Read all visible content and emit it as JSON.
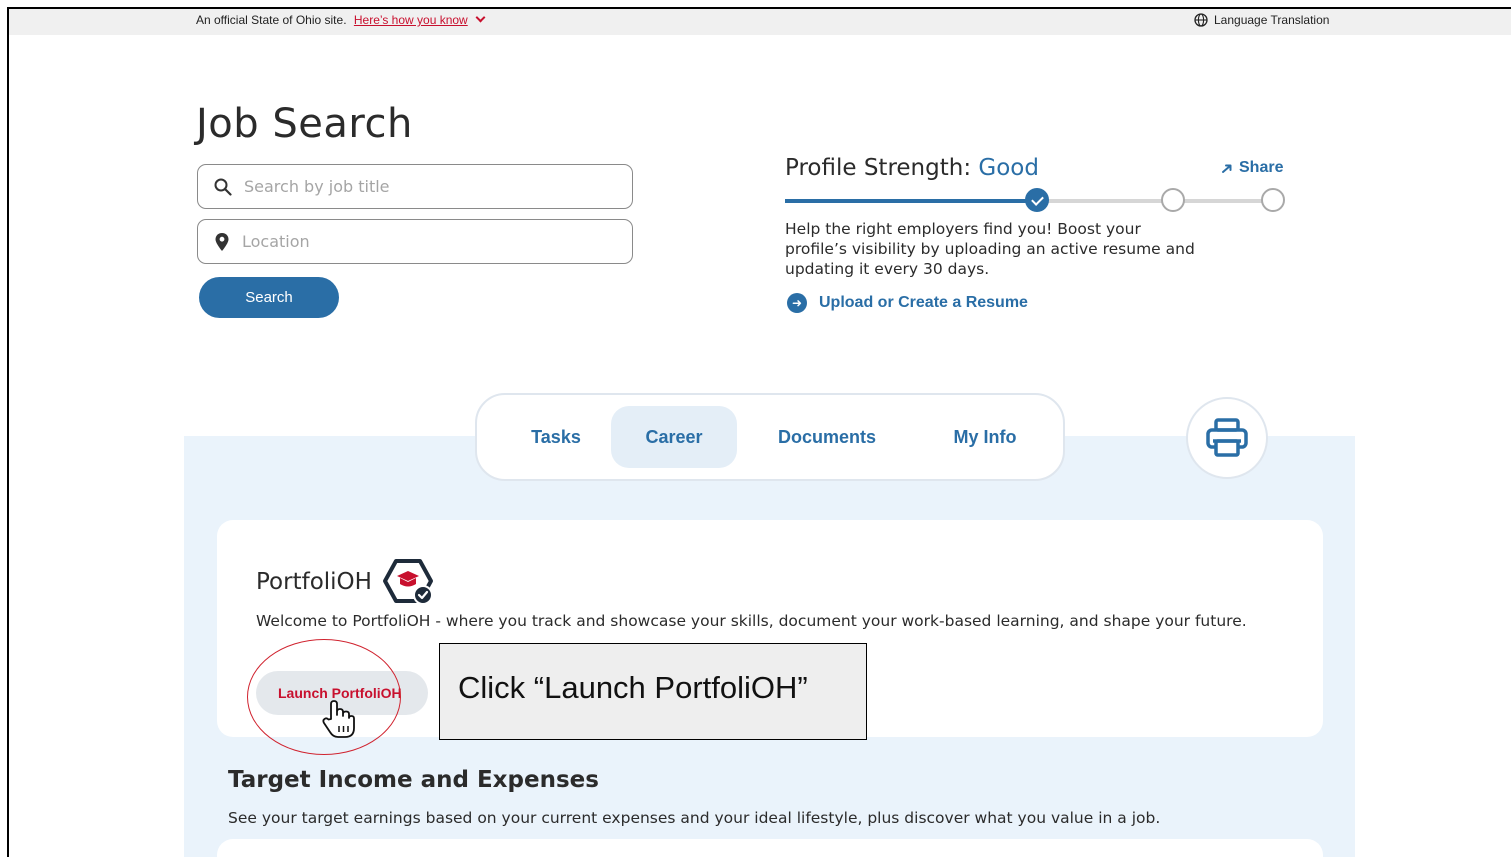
{
  "topbar": {
    "official_text": "An official State of Ohio site.",
    "how_you_know": "Here’s how you know",
    "language": "Language Translation"
  },
  "job_search": {
    "title": "Job Search",
    "search_placeholder": "Search by job title",
    "location_placeholder": "Location",
    "search_button": "Search"
  },
  "profile_strength": {
    "label": "Profile Strength: ",
    "level": "Good",
    "progress_fraction": 0.52,
    "share_label": "Share",
    "description": "Help the right employers find you! Boost your profile’s visibility by uploading an active resume and updating it every 30 days.",
    "upload_link": "Upload or Create a Resume"
  },
  "tabs": [
    {
      "label": "Tasks",
      "active": false
    },
    {
      "label": "Career",
      "active": true
    },
    {
      "label": "Documents",
      "active": false
    },
    {
      "label": "My Info",
      "active": false
    }
  ],
  "portfolioh": {
    "title": "PortfoliOH",
    "description": "Welcome to PortfoliOH - where you track and showcase your skills, document your work-based learning, and shape your future.",
    "launch_button": "Launch PortfoliOH"
  },
  "callout": {
    "text": "Click “Launch PortfoliOH”"
  },
  "target_income": {
    "title": "Target Income and Expenses",
    "description": "See your target earnings based on your current expenses and your ideal lifestyle, plus discover what you value in a job."
  },
  "colors": {
    "primary_blue": "#2a6ea6",
    "ohio_red": "#c8102e",
    "annotation_red": "#d0232f",
    "panel_light_blue": "#eaf3fb"
  },
  "icons": [
    "chevron-down-icon",
    "globe-icon",
    "search-icon",
    "location-pin-icon",
    "share-arrow-icon",
    "check-icon",
    "arrow-right-circle-icon",
    "printer-icon",
    "portfolioh-badge-icon",
    "pointer-hand-icon"
  ]
}
